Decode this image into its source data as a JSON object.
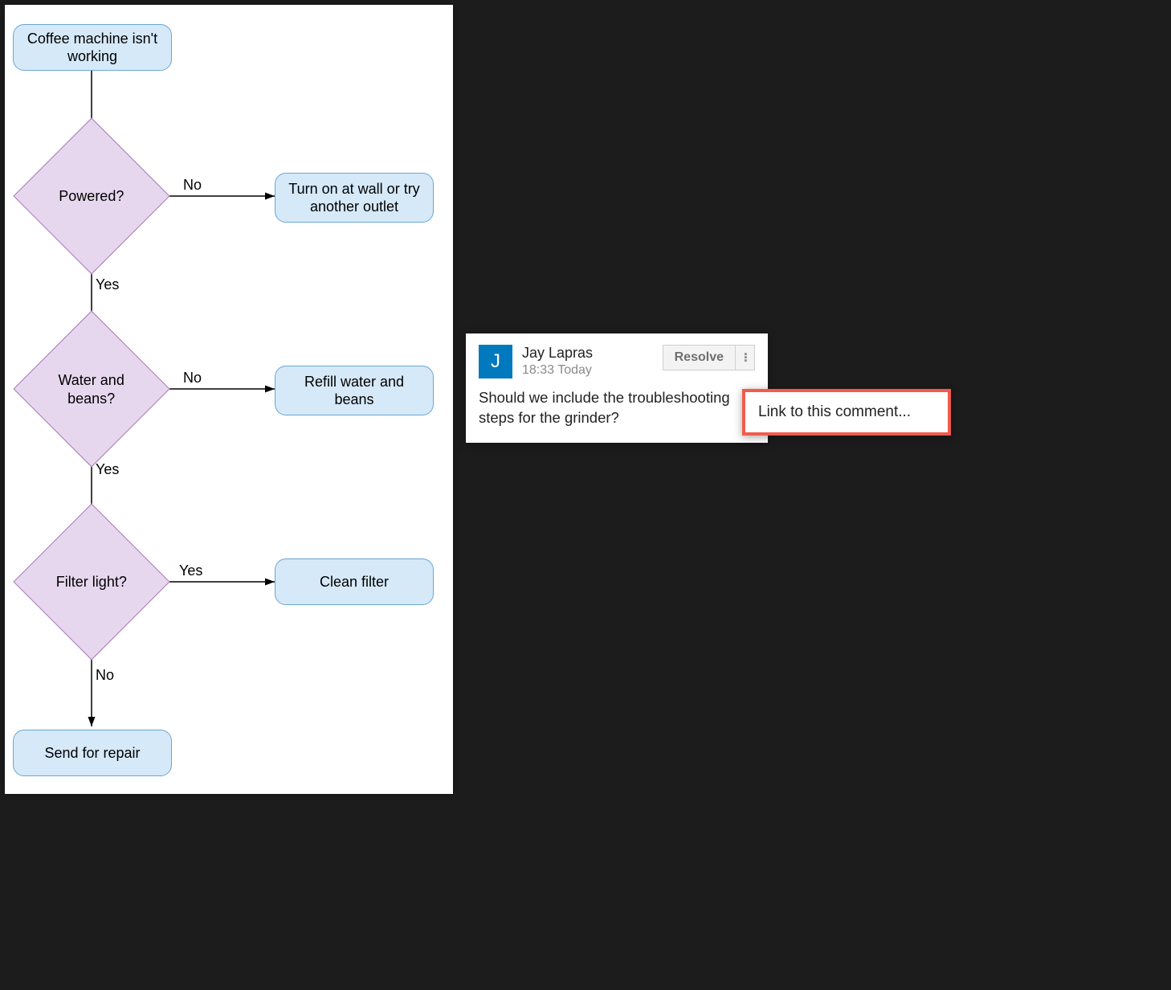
{
  "flowchart": {
    "nodes": {
      "start": "Coffee machine isn't working",
      "powered": "Powered?",
      "turn_on": "Turn on at wall or try another outlet",
      "water_beans": "Water and beans?",
      "refill": "Refill water and beans",
      "filter_light": "Filter light?",
      "clean_filter": "Clean filter",
      "send_repair": "Send for repair"
    },
    "edges": {
      "powered_no": "No",
      "powered_yes": "Yes",
      "water_no": "No",
      "water_yes": "Yes",
      "filter_yes": "Yes",
      "filter_no": "No"
    }
  },
  "comment": {
    "avatar_initial": "J",
    "author": "Jay Lapras",
    "timestamp": "18:33 Today",
    "resolve_label": "Resolve",
    "body": "Should we include the troubleshooting steps for the grinder?"
  },
  "menu": {
    "link_to_comment": "Link to this comment..."
  },
  "colors": {
    "terminator_fill": "#d6e9f8",
    "terminator_stroke": "#6aa6d6",
    "decision_fill": "#e7d7ee",
    "decision_stroke": "#a77bb8",
    "avatar_bg": "#0079bf",
    "highlight_border": "#f25b4c"
  }
}
